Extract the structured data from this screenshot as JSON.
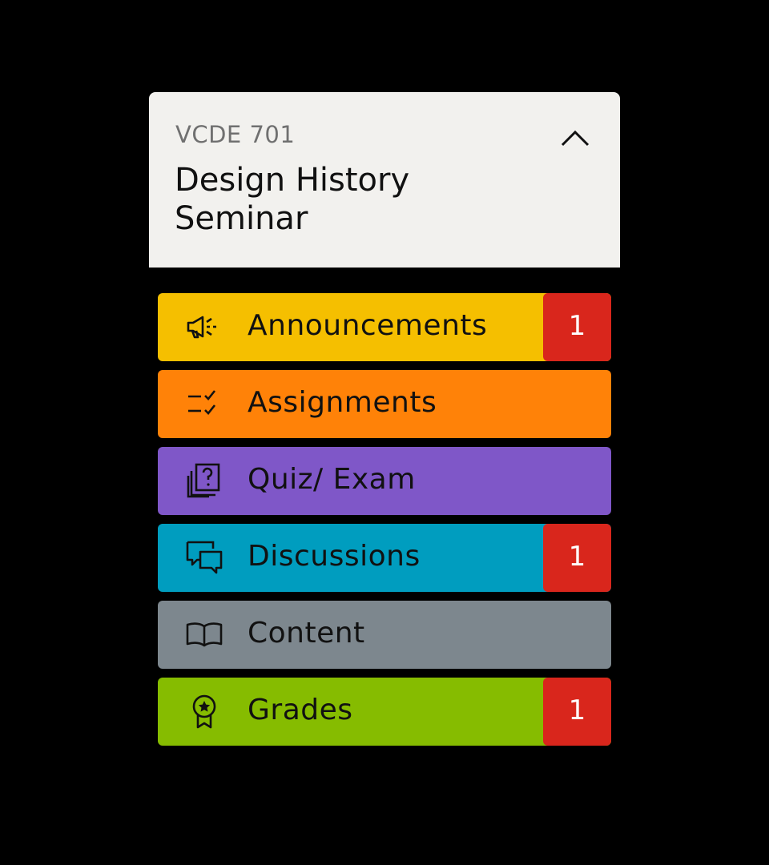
{
  "course": {
    "code": "VCDE 701",
    "title": "Design History Seminar"
  },
  "colors": {
    "header_bg": "#f2f1ee",
    "badge_bg": "#d9261c"
  },
  "nav": [
    {
      "label": "Announcements",
      "icon": "megaphone-icon",
      "color": "#f5bf00",
      "badge": "1"
    },
    {
      "label": "Assignments",
      "icon": "checklist-icon",
      "color": "#ff8208",
      "badge": ""
    },
    {
      "label": "Quiz/ Exam",
      "icon": "question-cards-icon",
      "color": "#7f57c8",
      "badge": ""
    },
    {
      "label": "Discussions",
      "icon": "chat-bubbles-icon",
      "color": "#009dbf",
      "badge": "1"
    },
    {
      "label": "Content",
      "icon": "open-book-icon",
      "color": "#7d878e",
      "badge": ""
    },
    {
      "label": "Grades",
      "icon": "award-ribbon-icon",
      "color": "#86bc00",
      "badge": "1"
    }
  ]
}
